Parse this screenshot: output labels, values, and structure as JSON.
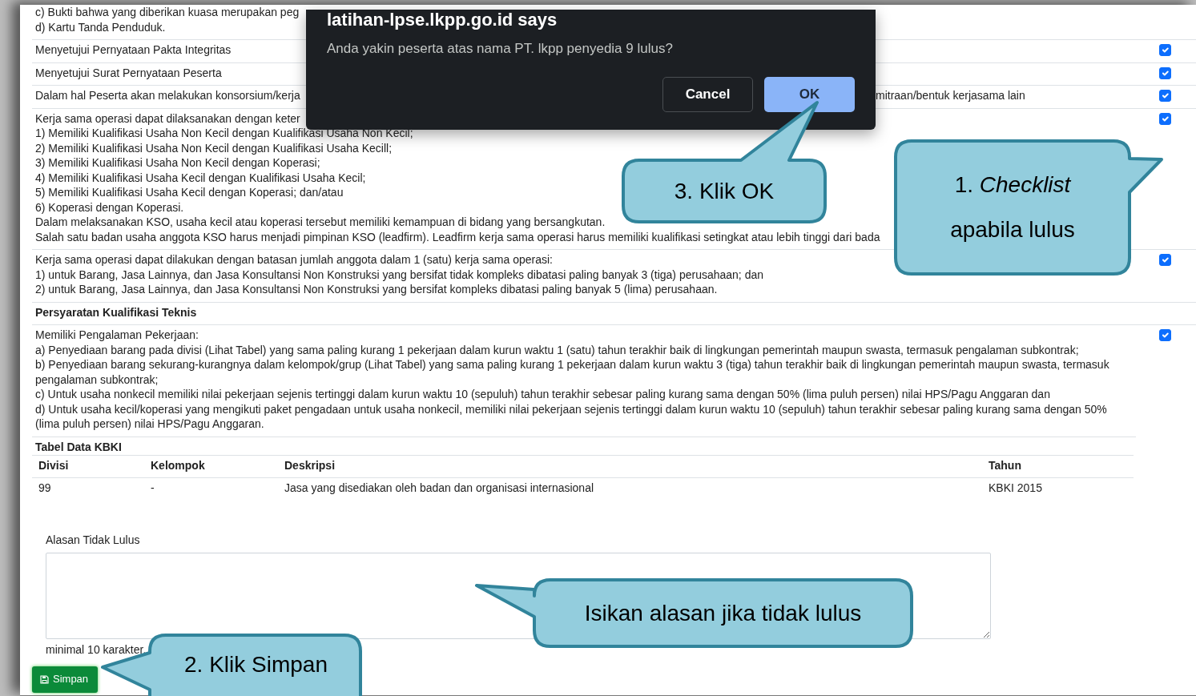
{
  "requirements": [
    {
      "kind": "text",
      "lines": [
        "c) Bukti bahwa yang diberikan kuasa merupakan peg",
        "d) Kartu Tanda Penduduk."
      ]
    },
    {
      "kind": "check",
      "checked": true,
      "lines": [
        "Menyetujui Pernyataan Pakta Integritas"
      ]
    },
    {
      "kind": "check",
      "checked": true,
      "lines": [
        "Menyetujui Surat Pernyataan Peserta"
      ]
    },
    {
      "kind": "check",
      "checked": true,
      "lines": [
        [
          "Dalam hal Peserta akan melakukan konsorsium/kerja",
          "mitraan/bentuk kerjasama lain"
        ]
      ]
    },
    {
      "kind": "check",
      "checked": true,
      "lines": [
        "Kerja sama operasi dapat dilaksanakan dengan keter",
        "1) Memiliki Kualifikasi Usaha Non Kecil dengan Kualifikasi Usaha Non Kecil;",
        "2) Memiliki Kualifikasi Usaha Non Kecil dengan Kualifikasi Usaha Kecill;",
        "3) Memiliki Kualifikasi Usaha Non Kecil dengan Koperasi;",
        "4) Memiliki Kualifikasi Usaha Kecil dengan Kualifikasi Usaha Kecil;",
        "5) Memiliki Kualifikasi Usaha Kecil dengan Koperasi; dan/atau",
        "6) Koperasi dengan Koperasi.",
        "Dalam melaksanakan KSO, usaha kecil atau koperasi tersebut memiliki kemampuan di bidang yang bersangkutan.",
        "Salah satu badan usaha anggota KSO harus menjadi pimpinan KSO (leadfirm). Leadfirm kerja sama operasi harus memiliki kualifikasi setingkat atau lebih tinggi dari bada"
      ]
    },
    {
      "kind": "check",
      "checked": true,
      "lines": [
        "Kerja sama operasi dapat dilakukan dengan batasan jumlah anggota dalam 1 (satu) kerja sama operasi:",
        "1) untuk Barang, Jasa Lainnya, dan Jasa Konsultansi Non Konstruksi yang bersifat tidak kompleks dibatasi paling banyak 3 (tiga) perusahaan; dan",
        "2) untuk Barang, Jasa Lainnya, dan Jasa Konsultansi Non Konstruksi yang bersifat kompleks dibatasi paling banyak 5 (lima) perusahaan."
      ]
    },
    {
      "kind": "heading",
      "lines": [
        "Persyaratan Kualifikasi Teknis"
      ]
    },
    {
      "kind": "check",
      "checked": true,
      "lines": [
        "Memiliki Pengalaman Pekerjaan:",
        "a) Penyediaan barang pada divisi (Lihat Tabel) yang sama paling kurang 1 pekerjaan dalam kurun waktu 1 (satu) tahun terakhir baik di lingkungan pemerintah maupun swasta, termasuk pengalaman subkontrak;",
        "b) Penyediaan barang sekurang-kurangnya dalam kelompok/grup (Lihat Tabel) yang sama paling kurang 1 pekerjaan dalam kurun waktu 3 (tiga) tahun terakhir baik di lingkungan pemerintah maupun swasta, termasuk",
        "pengalaman subkontrak;",
        "c) Untuk usaha nonkecil memiliki nilai pekerjaan sejenis tertinggi dalam kurun waktu 10 (sepuluh) tahun terakhir sebesar paling kurang sama dengan 50% (lima puluh persen) nilai HPS/Pagu Anggaran dan",
        "d) Untuk usaha kecil/koperasi yang mengikuti paket pengadaan untuk usaha nonkecil, memiliki nilai pekerjaan sejenis tertinggi dalam kurun waktu 10 (sepuluh) tahun terakhir sebesar paling kurang sama dengan 50%",
        "(lima puluh persen) nilai HPS/Pagu Anggaran."
      ]
    }
  ],
  "kbki_table": {
    "title": "Tabel Data KBKI",
    "columns": [
      "Divisi",
      "Kelompok",
      "Deskripsi",
      "Tahun"
    ],
    "rows": [
      [
        "99",
        "-",
        "Jasa yang disediakan oleh badan dan organisasi internasional",
        "KBKI 2015"
      ]
    ]
  },
  "reason": {
    "label": "Alasan Tidak Lulus",
    "hint": "minimal 10 karakter."
  },
  "save_button": {
    "label": "Simpan"
  },
  "dialog": {
    "title": "latihan-lpse.lkpp.go.id says",
    "message": "Anda yakin peserta atas nama PT. lkpp penyedia 9 lulus?",
    "buttons": [
      {
        "label": "Cancel",
        "kind": "secondary"
      },
      {
        "label": "OK",
        "kind": "primary"
      }
    ]
  },
  "callouts": [
    {
      "lines": [
        "3. Klik OK"
      ]
    },
    {
      "lines": [
        "1. *Checklist*",
        "apabila lulus"
      ]
    },
    {
      "lines": [
        "Isikan alasan jika tidak lulus"
      ]
    },
    {
      "lines": [
        "2. Klik Simpan"
      ]
    }
  ]
}
